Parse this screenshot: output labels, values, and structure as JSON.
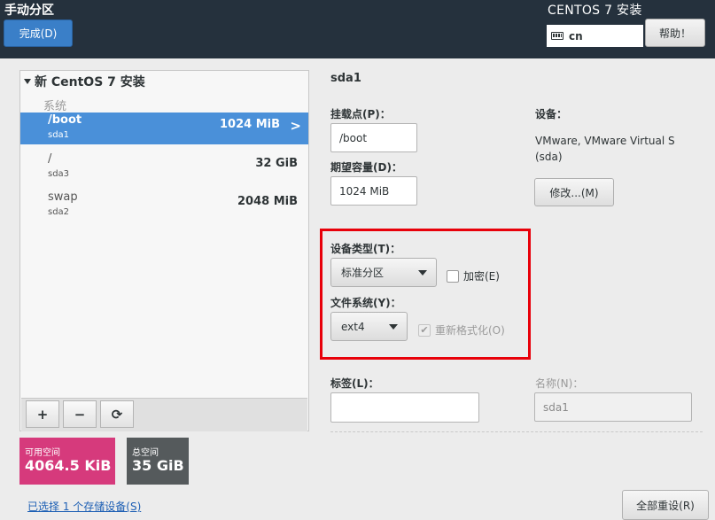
{
  "header": {
    "title": "手动分区",
    "done_label": "完成(D)",
    "product": "CENTOS 7 安装",
    "keyboard_layout": "cn",
    "help_label": "帮助！"
  },
  "tree": {
    "title": "新 CentOS 7 安装",
    "group_label": "系统",
    "partitions": [
      {
        "mount": "/boot",
        "device": "sda1",
        "size": "1024 MiB",
        "selected": true
      },
      {
        "mount": "/",
        "device": "sda3",
        "size": "32 GiB",
        "selected": false
      },
      {
        "mount": "swap",
        "device": "sda2",
        "size": "2048 MiB",
        "selected": false
      }
    ],
    "toolbar": {
      "add": "+",
      "remove": "−",
      "refresh": "⟳"
    }
  },
  "space": {
    "available_label": "可用空间",
    "available_value": "4064.5 KiB",
    "available_color": "#d63a7c",
    "total_label": "总空间",
    "total_value": "35 GiB",
    "total_color": "#555a5c"
  },
  "storage_link": "已选择 1 个存储设备(S)",
  "detail": {
    "device_title": "sda1",
    "mount_label": "挂载点(P)：",
    "mount_value": "/boot",
    "capacity_label": "期望容量(D)：",
    "capacity_value": "1024 MiB",
    "devices_label": "设备：",
    "devices_line1": "VMware, VMware Virtual S",
    "devices_line2": "(sda)",
    "modify_label": "修改...(M)",
    "device_type_label": "设备类型(T)：",
    "device_type_value": "标准分区",
    "encrypt_label": "加密(E)",
    "fs_label": "文件系统(Y)：",
    "fs_value": "ext4",
    "reformat_label": "重新格式化(O)",
    "tag_label": "标签(L)：",
    "tag_value": "",
    "name_label": "名称(N)：",
    "name_value": "sda1",
    "reset_label": "全部重设(R)"
  },
  "colors": {
    "header_bg": "#25313d",
    "selection": "#4a90d9",
    "highlight_frame": "#e8000a"
  }
}
